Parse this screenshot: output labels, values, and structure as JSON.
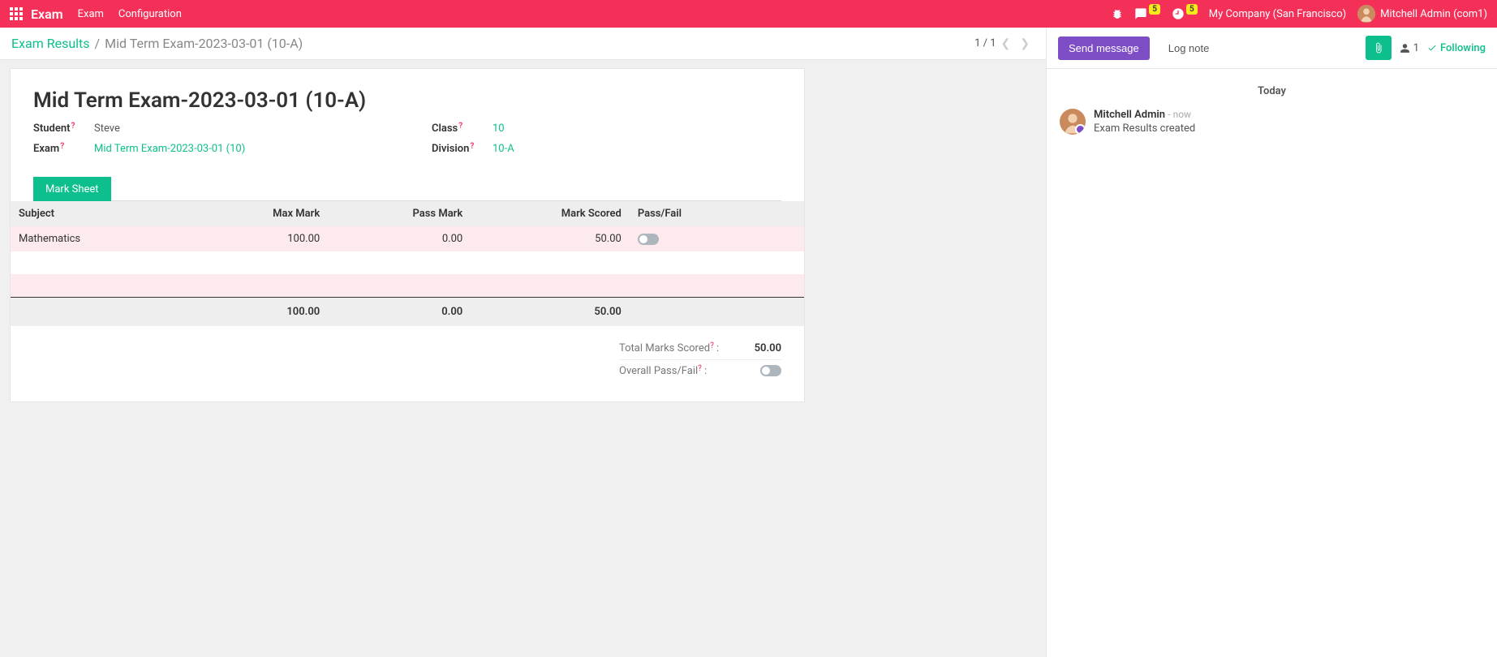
{
  "topnav": {
    "brand": "Exam",
    "menu1": "Exam",
    "menu2": "Configuration",
    "chat_badge": "5",
    "activity_badge": "5",
    "company": "My Company (San Francisco)",
    "user": "Mitchell Admin (com1)"
  },
  "breadcrumb": {
    "root": "Exam Results",
    "current": "Mid Term Exam-2023-03-01 (10-A)"
  },
  "pager": {
    "text": "1 / 1"
  },
  "record": {
    "title": "Mid Term Exam-2023-03-01 (10-A)",
    "labels": {
      "student": "Student",
      "exam": "Exam",
      "class": "Class",
      "division": "Division",
      "help": "?"
    },
    "values": {
      "student": "Steve",
      "exam": "Mid Term Exam-2023-03-01 (10)",
      "class": "10",
      "division": "10-A"
    }
  },
  "notebook": {
    "tab1": "Mark Sheet"
  },
  "table": {
    "headers": {
      "subject": "Subject",
      "max": "Max Mark",
      "pass": "Pass Mark",
      "scored": "Mark Scored",
      "pf": "Pass/Fail"
    },
    "rows": [
      {
        "subject": "Mathematics",
        "max": "100.00",
        "pass": "0.00",
        "scored": "50.00"
      }
    ],
    "totals": {
      "max": "100.00",
      "pass": "0.00",
      "scored": "50.00"
    }
  },
  "summary": {
    "total_label": "Total Marks Scored",
    "total_value": "50.00",
    "overall_label": "Overall Pass/Fail",
    "help": "?",
    "colon": " :"
  },
  "chatter": {
    "send": "Send message",
    "log": "Log note",
    "follower_count": "1",
    "following": "Following",
    "date": "Today",
    "msg_author": "Mitchell Admin",
    "msg_time": "- now",
    "msg_text": "Exam Results created"
  }
}
